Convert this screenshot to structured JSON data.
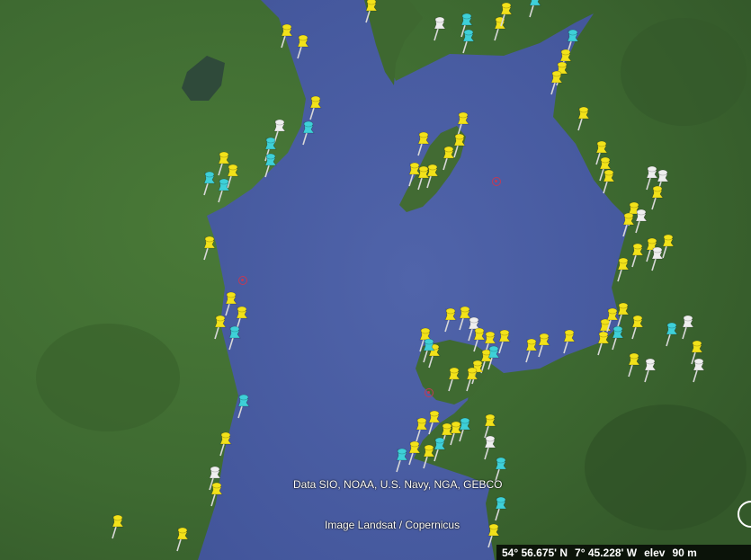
{
  "map": {
    "attribution_data": "Data SIO, NOAA, U.S. Navy, NGA, GEBCO",
    "attribution_image": "Image Landsat / Copernicus"
  },
  "status": {
    "latitude": "54° 56.675' N",
    "longitude": "7° 45.228' W",
    "elev_label": "elev",
    "elev_value": "90 m"
  },
  "pins": {
    "colors": {
      "yellow": "#f2e21a",
      "cyan": "#3ed0d8",
      "white": "#eeeeee"
    },
    "icon": "pushpin-icon"
  },
  "colors": {
    "sea": "#4b5fa3",
    "land": "#3f6a33",
    "marker": "#c23a55"
  }
}
